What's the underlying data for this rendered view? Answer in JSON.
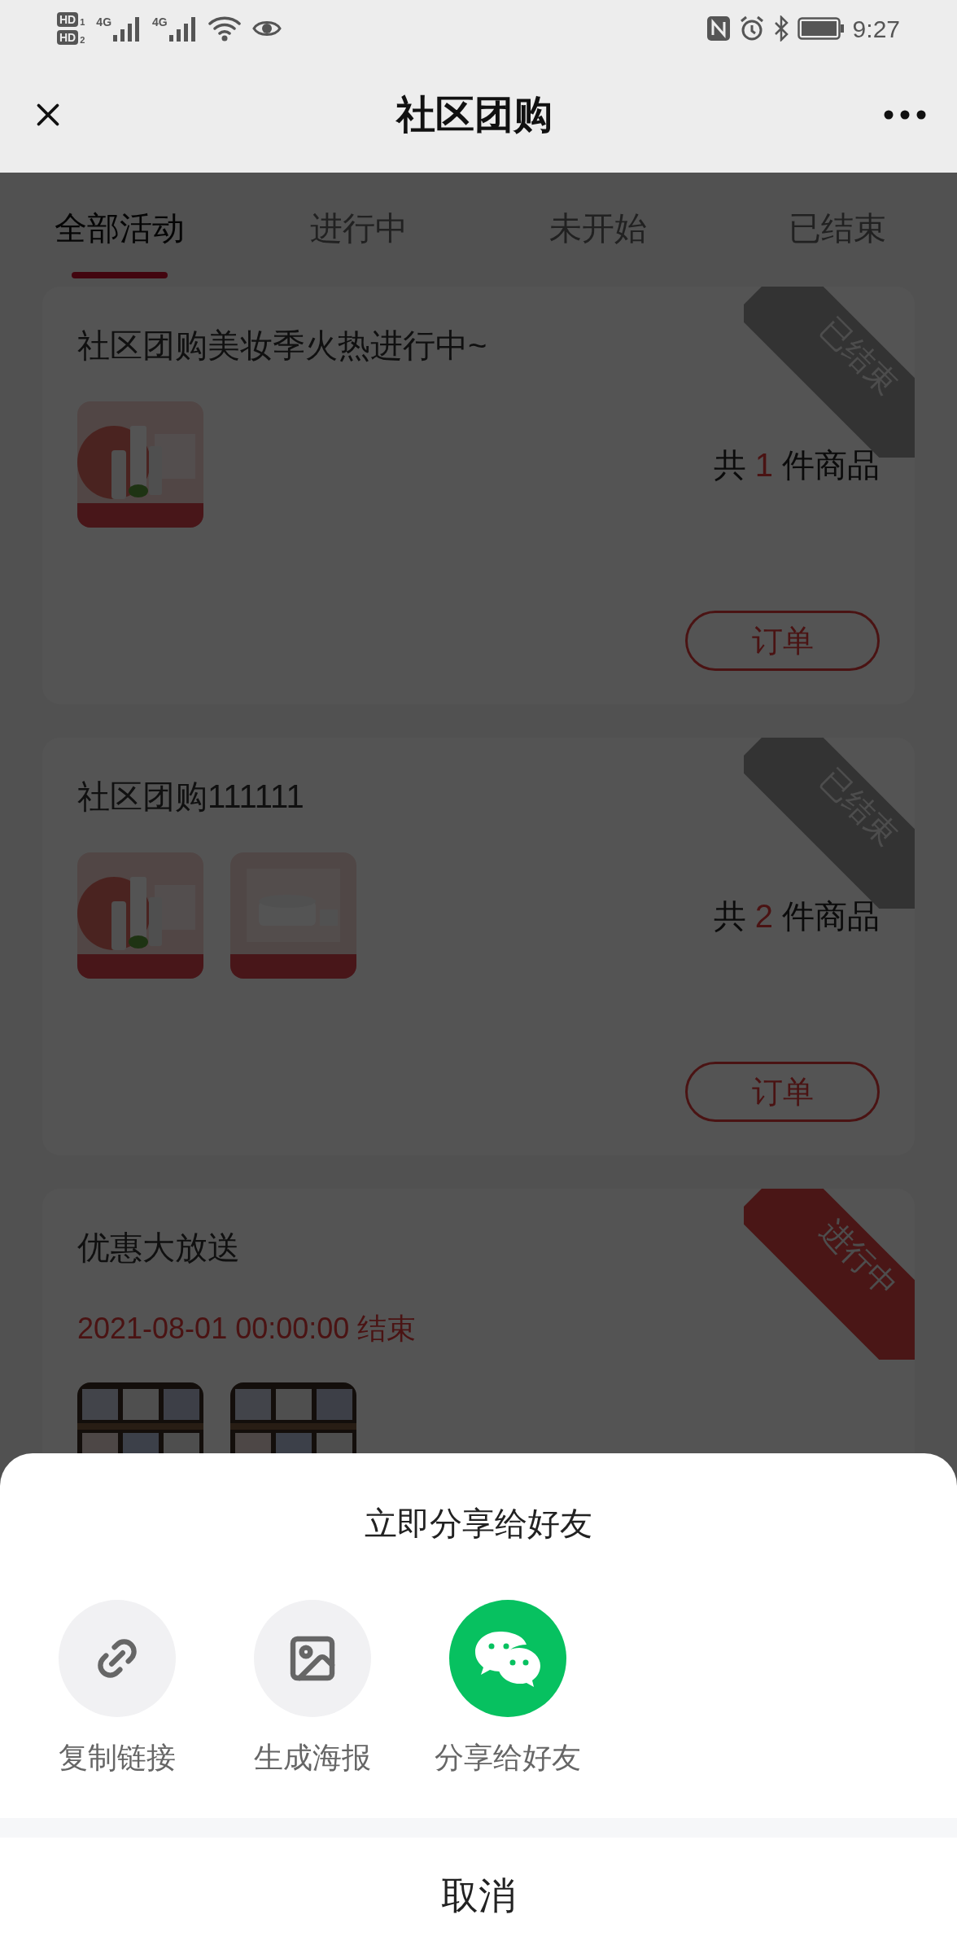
{
  "status_bar": {
    "sim_badges": [
      {
        "label": "HD",
        "index": "1"
      },
      {
        "label": "HD",
        "index": "2"
      }
    ],
    "networks": [
      "4G",
      "4G"
    ],
    "time": "9:27"
  },
  "nav": {
    "title": "社区团购"
  },
  "tabs": [
    {
      "label": "全部活动",
      "selected": true
    },
    {
      "label": "进行中",
      "selected": false
    },
    {
      "label": "未开始",
      "selected": false
    },
    {
      "label": "已结束",
      "selected": false
    }
  ],
  "activities": [
    {
      "title": "社区团购美妆季火热进行中~",
      "status": {
        "kind": "ended",
        "label": "已结束"
      },
      "thumbnails": [
        {
          "kind": "cosmetics"
        }
      ],
      "count": {
        "prefix": "共",
        "number": "1",
        "suffix": "件商品"
      },
      "order_button": "订单"
    },
    {
      "title": "社区团购111111",
      "status": {
        "kind": "ended",
        "label": "已结束"
      },
      "thumbnails": [
        {
          "kind": "cosmetics"
        },
        {
          "kind": "cream"
        }
      ],
      "count": {
        "prefix": "共",
        "number": "2",
        "suffix": "件商品"
      },
      "order_button": "订单"
    },
    {
      "title": "优惠大放送",
      "status": {
        "kind": "ongoing",
        "label": "进行中"
      },
      "end_time": "2021-08-01 00:00:00 结束",
      "thumbnails": [
        {
          "kind": "shirts"
        },
        {
          "kind": "shirts"
        }
      ]
    }
  ],
  "share_sheet": {
    "title": "立即分享给好友",
    "options": [
      {
        "kind": "link",
        "label": "复制链接"
      },
      {
        "kind": "poster",
        "label": "生成海报"
      },
      {
        "kind": "wechat",
        "label": "分享给好友"
      }
    ],
    "cancel": "取消"
  }
}
